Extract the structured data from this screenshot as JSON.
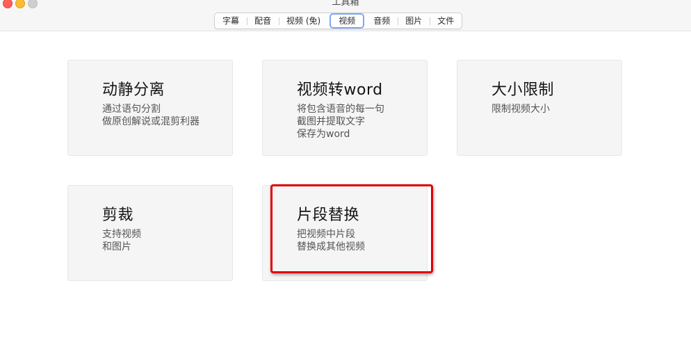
{
  "window": {
    "title": "工具箱"
  },
  "tabs": [
    {
      "label": "字幕",
      "selected": false
    },
    {
      "label": "配音",
      "selected": false
    },
    {
      "label": "视频 (免)",
      "selected": false
    },
    {
      "label": "视频",
      "selected": true
    },
    {
      "label": "音频",
      "selected": false
    },
    {
      "label": "图片",
      "selected": false
    },
    {
      "label": "文件",
      "selected": false
    }
  ],
  "cards": [
    {
      "title": "动静分离",
      "desc": "通过语句分割\n做原创解说或混剪利器"
    },
    {
      "title": "视频转word",
      "desc": "将包含语音的每一句\n截图并提取文字\n保存为word"
    },
    {
      "title": "大小限制",
      "desc": "限制视频大小"
    },
    {
      "title": "剪裁",
      "desc": "支持视频\n和图片"
    },
    {
      "title": "片段替换",
      "desc": "把视频中片段\n替换成其他视频"
    }
  ],
  "colors": {
    "highlight_border": "#e00000",
    "selected_tab_border": "#7ea8f6",
    "card_background": "#f5f5f5"
  }
}
